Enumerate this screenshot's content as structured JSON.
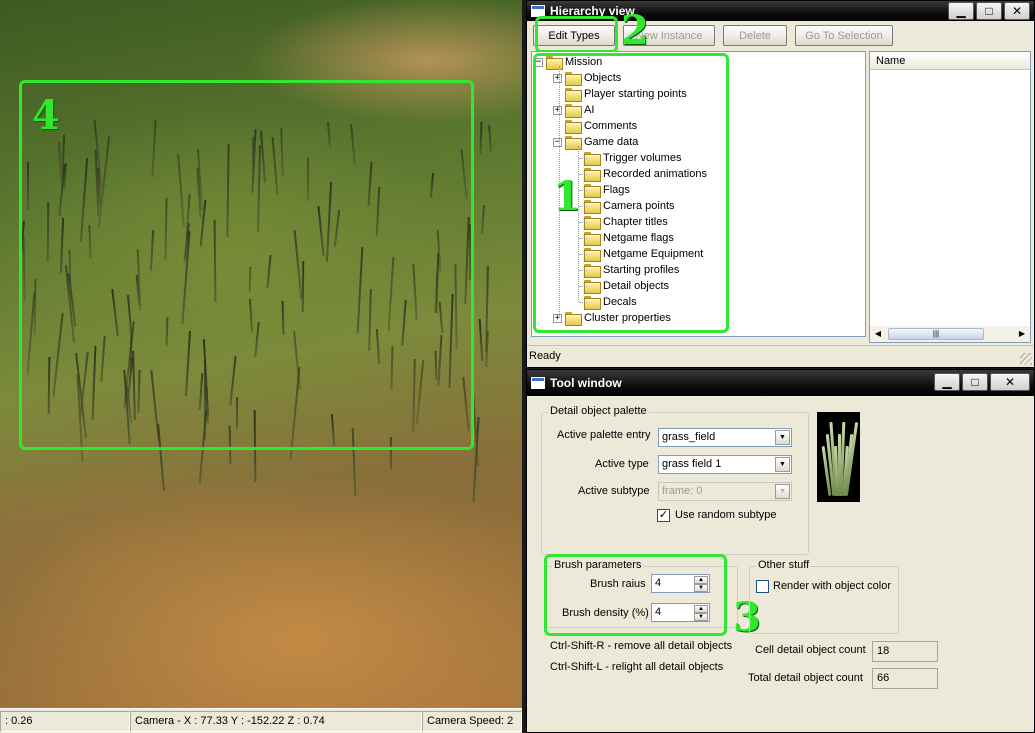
{
  "viewport": {
    "annotation_label": "4"
  },
  "viewport_status": {
    "zoom": ": 0.26",
    "camera": "Camera - X : 77.33  Y : -152.22  Z : 0.74",
    "speed": "Camera Speed: 2"
  },
  "hierarchy": {
    "title": "Hierarchy view",
    "toolbar": {
      "edit_types": "Edit Types",
      "new_instance": "New Instance",
      "delete": "Delete",
      "go_to_selection": "Go To Selection"
    },
    "tree": {
      "root": "Mission",
      "items": [
        "Objects",
        "Player starting points",
        "AI",
        "Comments",
        "Game data",
        "Cluster properties"
      ],
      "game_data_children": [
        "Trigger volumes",
        "Recorded animations",
        "Flags",
        "Camera points",
        "Chapter titles",
        "Netgame flags",
        "Netgame Equipment",
        "Starting profiles",
        "Detail objects",
        "Decals"
      ]
    },
    "name_column": "Name",
    "status": "Ready",
    "annotation_tree": "1",
    "annotation_toolbar": "2"
  },
  "tool": {
    "title": "Tool window",
    "palette": {
      "group_label": "Detail object palette",
      "active_palette_entry_label": "Active palette entry",
      "active_palette_entry_value": "grass_field",
      "active_type_label": "Active type",
      "active_type_value": "grass field 1",
      "active_subtype_label": "Active subtype",
      "active_subtype_value": "frame: 0",
      "use_random_subtype_label": "Use random subtype",
      "use_random_subtype_checked": true
    },
    "brush": {
      "group_label": "Brush parameters",
      "radius_label": "Brush raius",
      "radius_value": "4",
      "density_label": "Brush density (%)",
      "density_value": "4"
    },
    "other": {
      "group_label": "Other stuff",
      "render_with_object_color_label": "Render with object color",
      "render_with_object_color_checked": false
    },
    "hints": {
      "remove": "Ctrl-Shift-R - remove all detail objects",
      "relight": "Ctrl-Shift-L - relight all detail objects"
    },
    "counts": {
      "cell_label": "Cell detail object count",
      "cell_value": "18",
      "total_label": "Total detail object count",
      "total_value": "66"
    },
    "annotation_brush": "3"
  },
  "window_buttons": {
    "minimize": "▁",
    "maximize": "□",
    "close": "✕"
  },
  "colors": {
    "annotation": "#2fe82f",
    "titlebar": "#000000",
    "window_bg": "#ece9d8"
  }
}
